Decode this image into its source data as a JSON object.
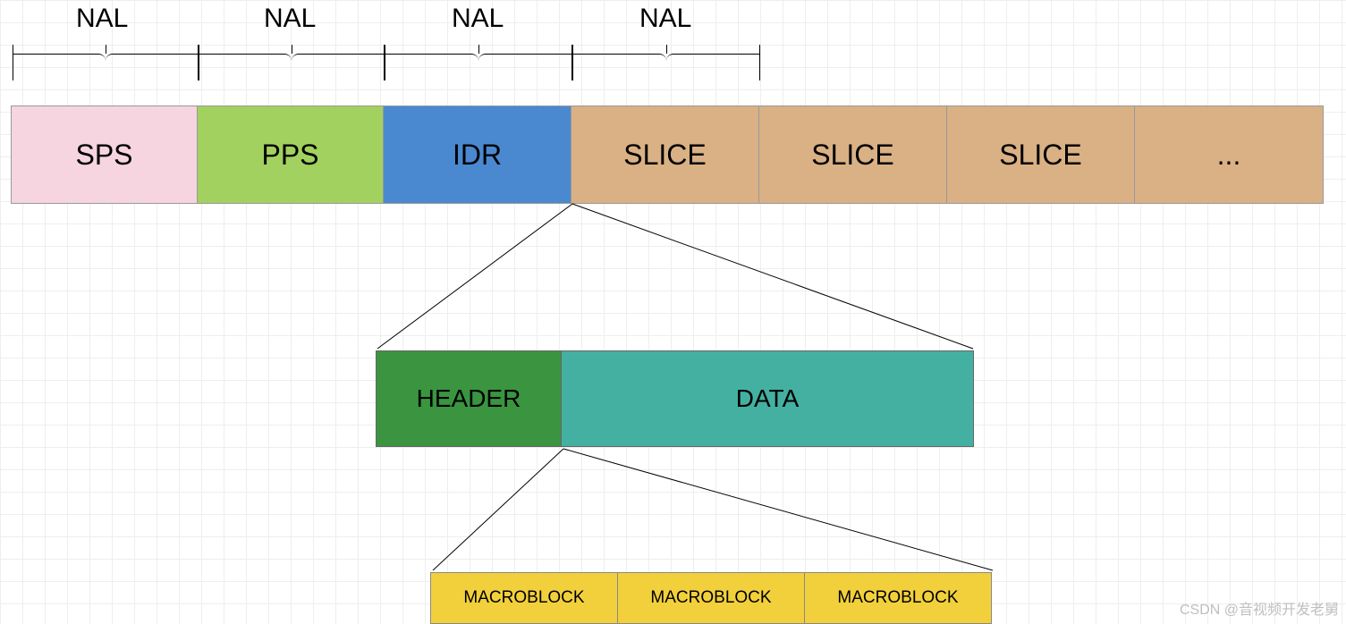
{
  "nal_labels": [
    "NAL",
    "NAL",
    "NAL",
    "NAL"
  ],
  "row1": {
    "sps": "SPS",
    "pps": "PPS",
    "idr": "IDR",
    "slice1": "SLICE",
    "slice2": "SLICE",
    "slice3": "SLICE",
    "dots": "..."
  },
  "row2": {
    "header": "HEADER",
    "data": "DATA"
  },
  "row3": {
    "mb1": "MACROBLOCK",
    "mb2": "MACROBLOCK",
    "mb3": "MACROBLOCK"
  },
  "watermark": "CSDN @音视频开发老舅"
}
